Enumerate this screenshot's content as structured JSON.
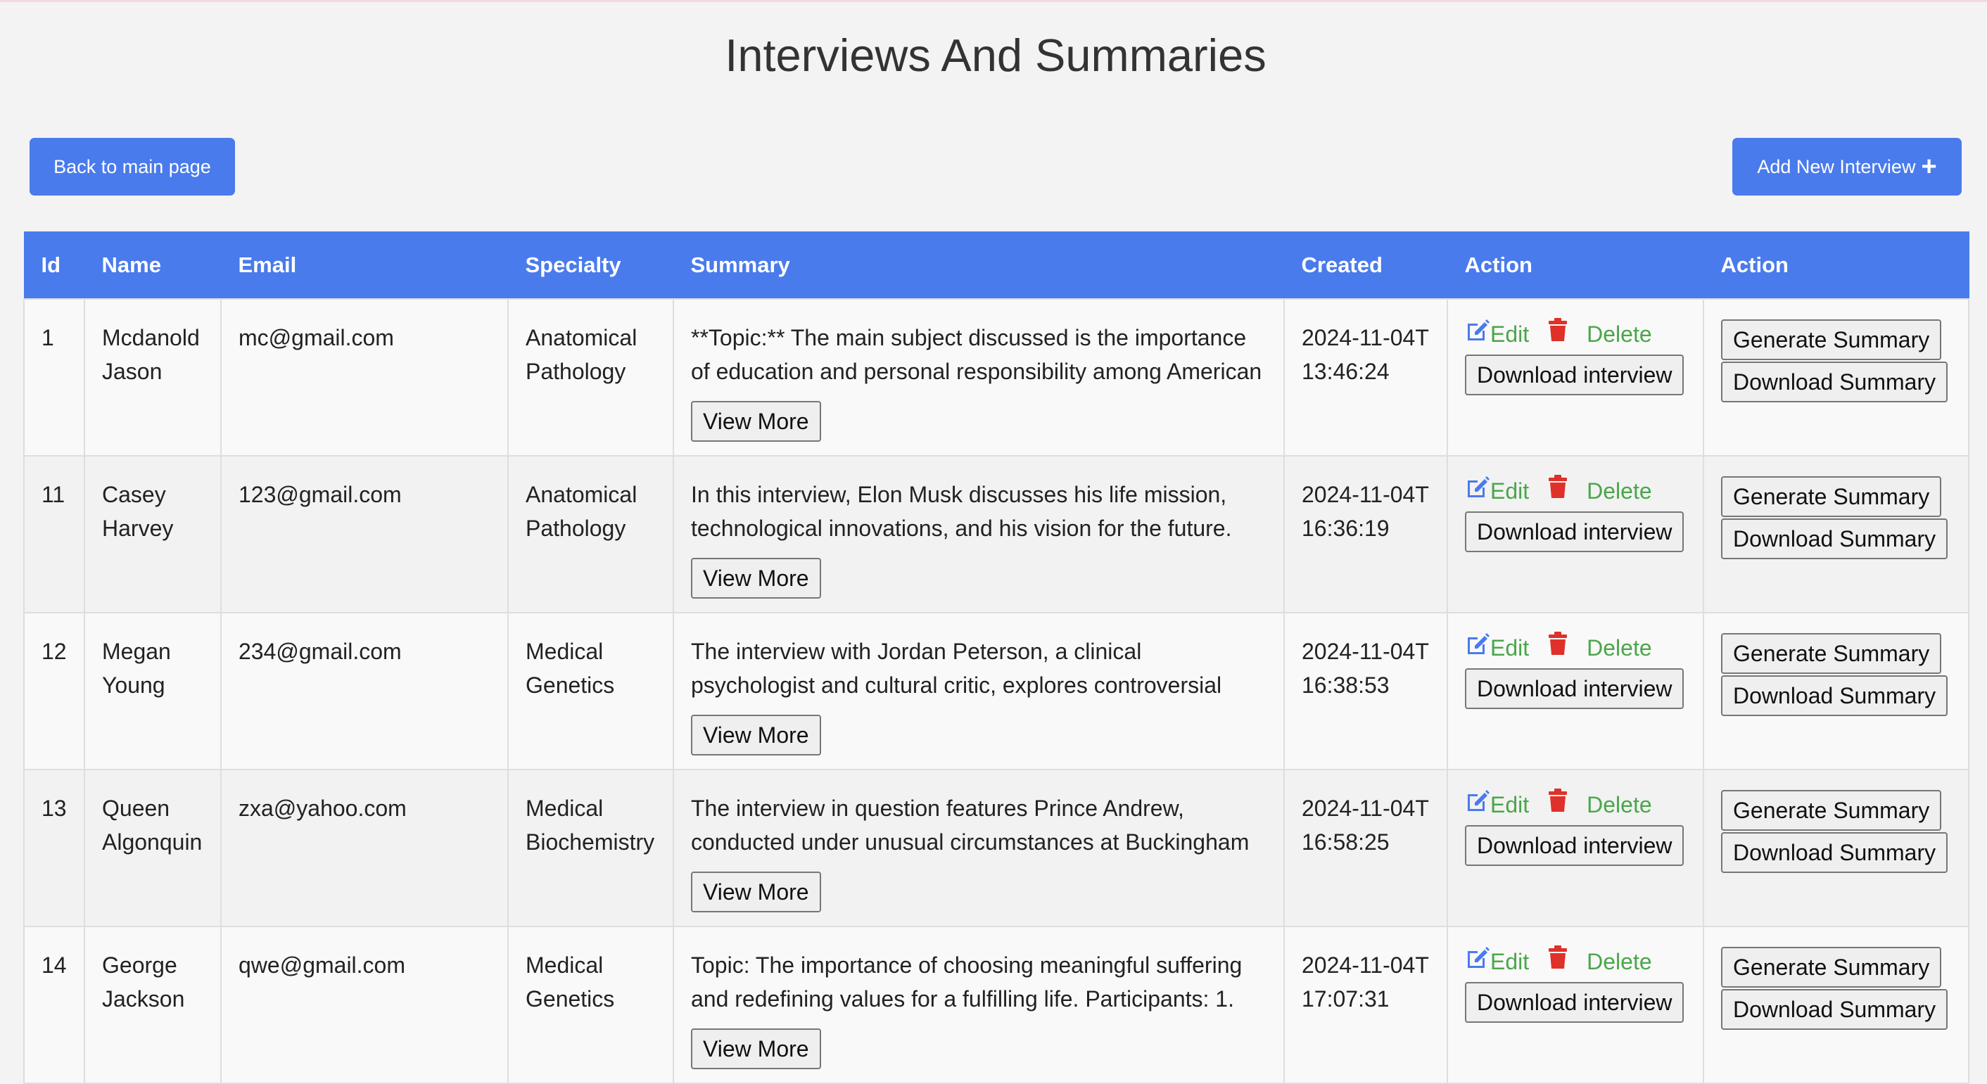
{
  "page": {
    "title": "Interviews And Summaries"
  },
  "buttons": {
    "back": "Back to main page",
    "add": "Add New Interview",
    "view_more": "View More",
    "edit": "Edit",
    "delete": "Delete",
    "download_interview": "Download interview",
    "generate_summary": "Generate Summary",
    "download_summary": "Download Summary"
  },
  "icons": {
    "add": "plus-icon",
    "edit": "edit-icon",
    "delete": "trash-icon"
  },
  "colors": {
    "primary": "#4a7bec",
    "link_green": "#4aa64a",
    "trash_red": "#e0302a",
    "edit_blue": "#4a7bec"
  },
  "table": {
    "headers": [
      "Id",
      "Name",
      "Email",
      "Specialty",
      "Summary",
      "Created",
      "Action",
      "Action"
    ],
    "rows": [
      {
        "id": "1",
        "name": "Mcdanold Jason",
        "email": "mc@gmail.com",
        "specialty": "Anatomical Pathology",
        "summary": "**Topic:** The main subject discussed is the importance of education and personal responsibility among American",
        "created": "2024-11-04T13:46:24"
      },
      {
        "id": "11",
        "name": "Casey Harvey",
        "email": "123@gmail.com",
        "specialty": "Anatomical Pathology",
        "summary": "In this interview, Elon Musk discusses his life mission, technological innovations, and his vision for the future.",
        "created": "2024-11-04T16:36:19"
      },
      {
        "id": "12",
        "name": "Megan Young",
        "email": "234@gmail.com",
        "specialty": "Medical Genetics",
        "summary": "The interview with Jordan Peterson, a clinical psychologist and cultural critic, explores controversial",
        "created": "2024-11-04T16:38:53"
      },
      {
        "id": "13",
        "name": "Queen Algonquin",
        "email": "zxa@yahoo.com",
        "specialty": "Medical Biochemistry",
        "summary": "The interview in question features Prince Andrew, conducted under unusual circumstances at Buckingham",
        "created": "2024-11-04T16:58:25"
      },
      {
        "id": "14",
        "name": "George Jackson",
        "email": "qwe@gmail.com",
        "specialty": "Medical Genetics",
        "summary": "Topic: The importance of choosing meaningful suffering and redefining values for a fulfilling life. Participants: 1.",
        "created": "2024-11-04T17:07:31"
      }
    ]
  }
}
